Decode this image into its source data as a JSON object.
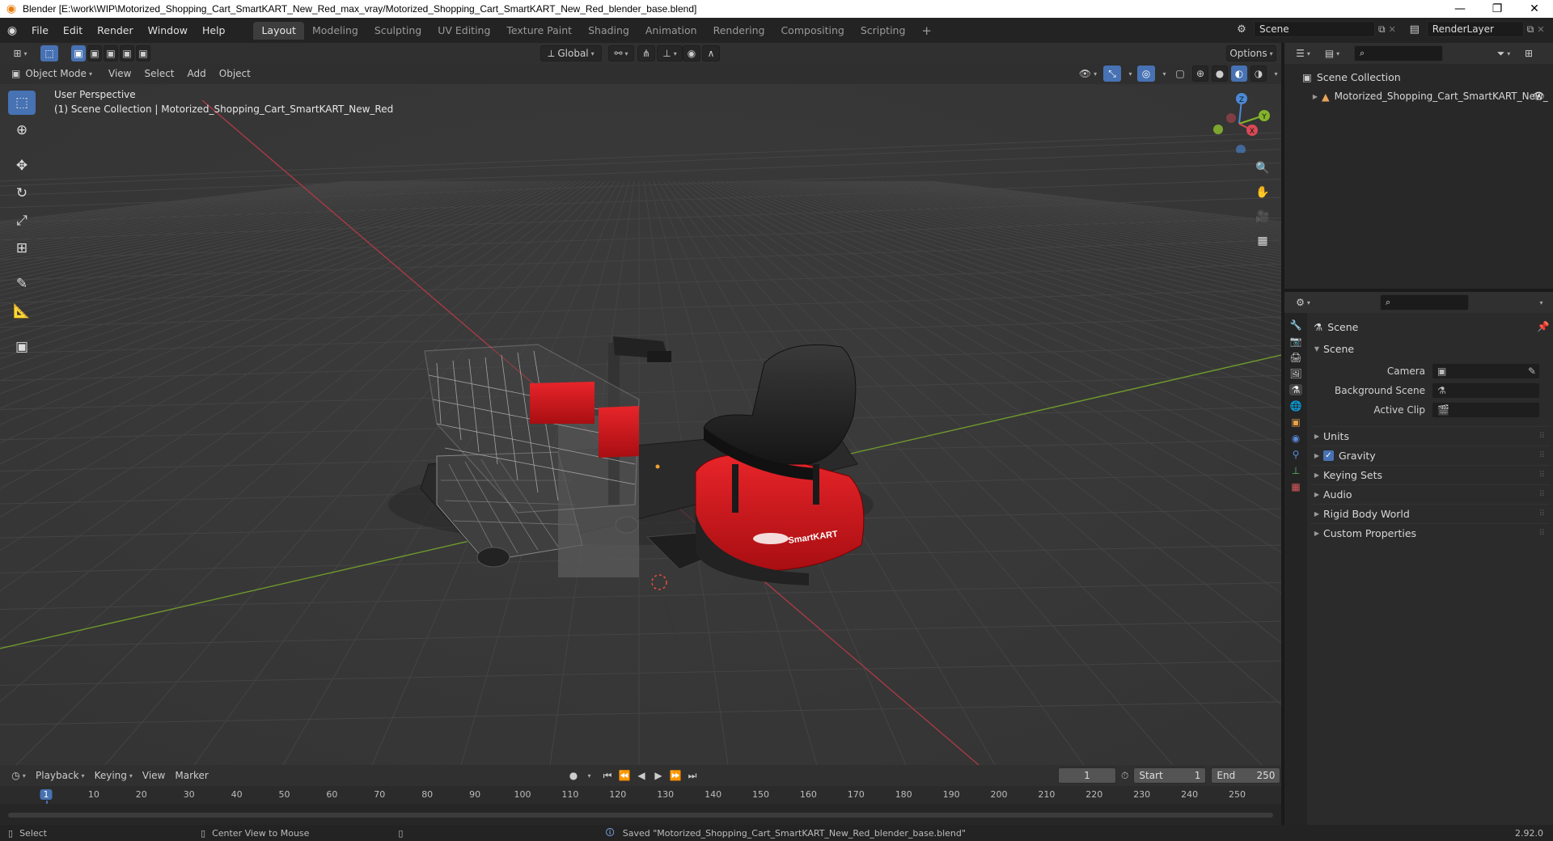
{
  "window": {
    "title": "Blender [E:\\work\\WIP\\Motorized_Shopping_Cart_SmartKART_New_Red_max_vray/Motorized_Shopping_Cart_SmartKART_New_Red_blender_base.blend]",
    "minimize": "—",
    "maximize": "❐",
    "close": "✕"
  },
  "menu": {
    "items": [
      "File",
      "Edit",
      "Render",
      "Window",
      "Help"
    ]
  },
  "workspaces": {
    "tabs": [
      "Layout",
      "Modeling",
      "Sculpting",
      "UV Editing",
      "Texture Paint",
      "Shading",
      "Animation",
      "Rendering",
      "Compositing",
      "Scripting"
    ],
    "active": "Layout",
    "add": "+"
  },
  "scene_selector": {
    "value": "Scene"
  },
  "renderlayer_selector": {
    "value": "RenderLayer"
  },
  "tool_header": {
    "transform_orientation": "Global",
    "options": "Options"
  },
  "viewport_header": {
    "mode": "Object Mode",
    "menus": [
      "View",
      "Select",
      "Add",
      "Object"
    ]
  },
  "viewport": {
    "perspective": "User Perspective",
    "collection_info": "(1) Scene Collection | Motorized_Shopping_Cart_SmartKART_New_Red",
    "cart_brand": "SmartKART",
    "gizmo": {
      "x": "X",
      "y": "Y",
      "z": "Z"
    }
  },
  "outliner": {
    "root": "Scene Collection",
    "items": [
      {
        "label": "Motorized_Shopping_Cart_SmartKART_New_"
      }
    ]
  },
  "properties": {
    "header": "Scene",
    "section": "Scene",
    "fields": [
      {
        "label": "Camera",
        "value": ""
      },
      {
        "label": "Background Scene",
        "value": ""
      },
      {
        "label": "Active Clip",
        "value": ""
      }
    ],
    "panels": [
      {
        "label": "Units",
        "checkbox": false
      },
      {
        "label": "Gravity",
        "checkbox": true
      },
      {
        "label": "Keying Sets",
        "checkbox": false
      },
      {
        "label": "Audio",
        "checkbox": false
      },
      {
        "label": "Rigid Body World",
        "checkbox": false
      },
      {
        "label": "Custom Properties",
        "checkbox": false
      }
    ]
  },
  "timeline": {
    "menus": [
      "Playback",
      "Keying",
      "View",
      "Marker"
    ],
    "current_frame": "1",
    "start_label": "Start",
    "start_value": "1",
    "end_label": "End",
    "end_value": "250",
    "ruler": [
      "1",
      "10",
      "20",
      "30",
      "40",
      "50",
      "60",
      "70",
      "80",
      "90",
      "100",
      "110",
      "120",
      "130",
      "140",
      "150",
      "160",
      "170",
      "180",
      "190",
      "200",
      "210",
      "220",
      "230",
      "240",
      "250"
    ]
  },
  "statusbar": {
    "select": "Select",
    "center_view": "Center View to Mouse",
    "message": "Saved \"Motorized_Shopping_Cart_SmartKART_New_Red_blender_base.blend\"",
    "version": "2.92.0"
  },
  "colors": {
    "accent": "#4772b3",
    "x_axis": "#a83a45",
    "y_axis": "#6f9a2c",
    "cart_red": "#d0161c"
  }
}
